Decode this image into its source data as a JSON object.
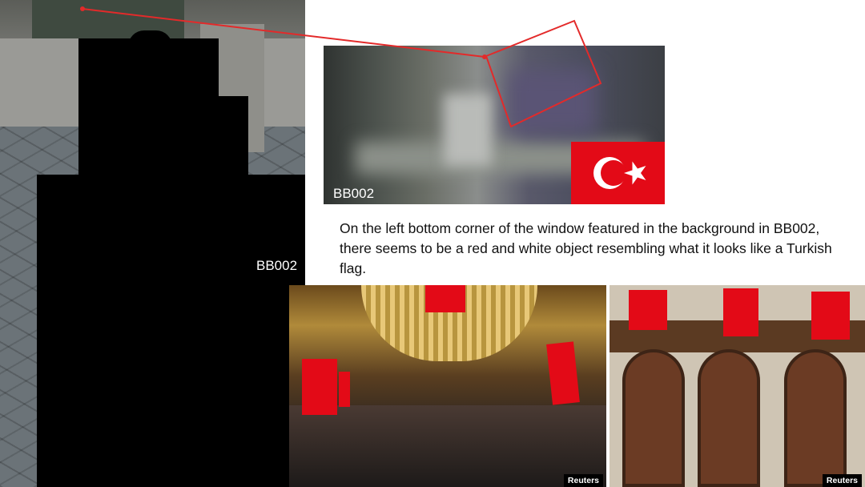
{
  "left_photo": {
    "label": "BB002"
  },
  "zoom_crop": {
    "label": "BB002"
  },
  "description": "On the left bottom corner of the window featured in the background in BB002, there seems to be a red and white object resembling what it looks like a Turkish flag.",
  "photo_credits": [
    "Reuters",
    "Reuters"
  ],
  "colors": {
    "flag_red": "#e30a17",
    "annotation_red": "#e32a2a"
  },
  "icons": [
    "turkish-flag-icon"
  ]
}
